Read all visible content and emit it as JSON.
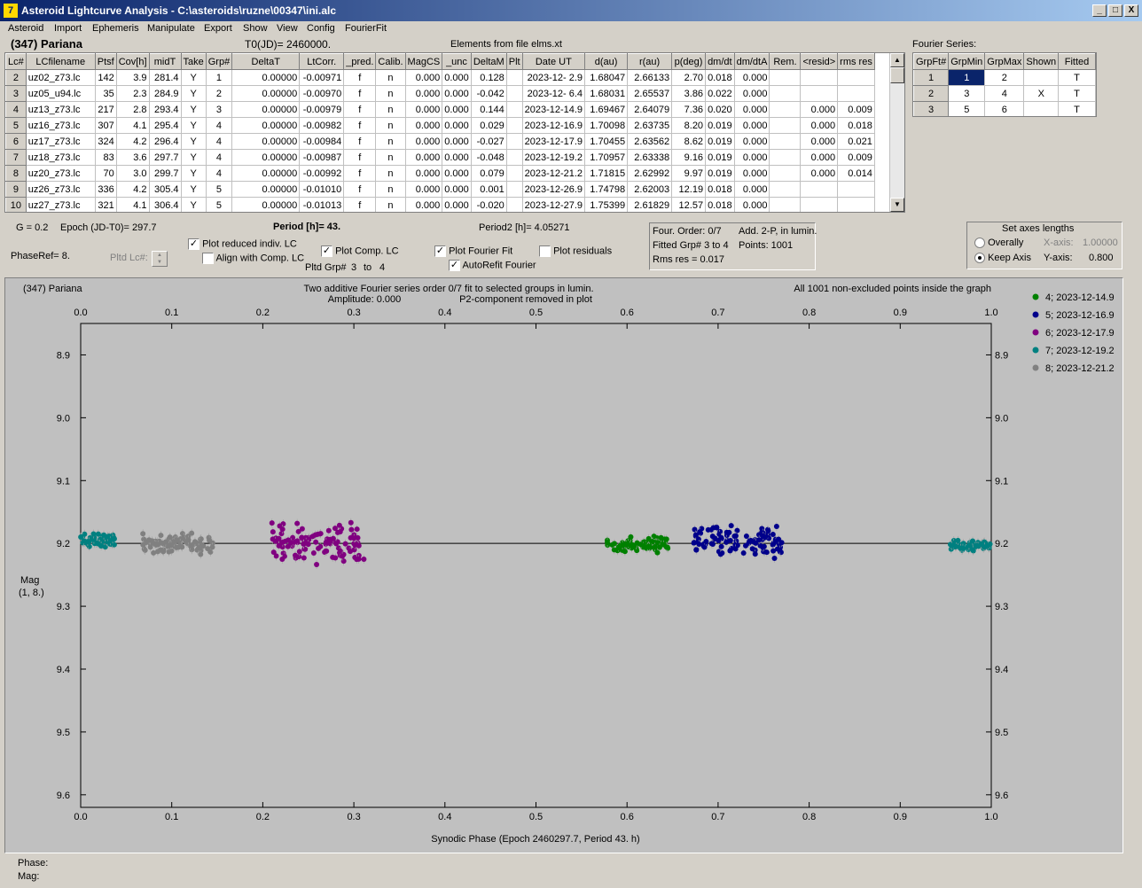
{
  "window": {
    "title": "Asteroid Lightcurve Analysis - C:\\asteroids\\ruzne\\00347\\ini.alc",
    "icon_name": "app-icon",
    "buttons": {
      "minimize": "_",
      "maximize": "□",
      "close": "X"
    }
  },
  "menu": [
    "Asteroid",
    "Import",
    "Ephemeris",
    "Manipulate",
    "Export",
    "Show",
    "View",
    "Config",
    "FourierFit"
  ],
  "header": {
    "object": "(347) Pariana",
    "t0": "T0(JD)= 2460000.",
    "elements": "Elements from file elms.xt",
    "fourier_label": "Fourier Series:"
  },
  "lc_table": {
    "columns": [
      "Lc#",
      "LCfilename",
      "Ptsf",
      "Cov[h]",
      "midT",
      "Take",
      "Grp#",
      "DeltaT",
      "LtCorr.",
      "_pred.",
      "Calib.",
      "MagCS",
      "_unc",
      "DeltaM",
      "Plt",
      "Date UT",
      "d(au)",
      "r(au)",
      "p(deg)",
      "dm/dt",
      "dm/dtA",
      "Rem.",
      "<resid>",
      "rms res"
    ],
    "rows": [
      [
        "2",
        "uz02_z73.lc",
        "142",
        "3.9",
        "281.4",
        "Y",
        "1",
        "0.00000",
        "-0.00971",
        "f",
        "n",
        "0.000",
        "0.000",
        "0.128",
        "",
        "2023-12- 2.9",
        "1.68047",
        "2.66133",
        "2.70",
        "0.018",
        "0.000",
        "",
        "",
        ""
      ],
      [
        "3",
        "uz05_u94.lc",
        "35",
        "2.3",
        "284.9",
        "Y",
        "2",
        "0.00000",
        "-0.00970",
        "f",
        "n",
        "0.000",
        "0.000",
        "-0.042",
        "",
        "2023-12- 6.4",
        "1.68031",
        "2.65537",
        "3.86",
        "0.022",
        "0.000",
        "",
        "",
        ""
      ],
      [
        "4",
        "uz13_z73.lc",
        "217",
        "2.8",
        "293.4",
        "Y",
        "3",
        "0.00000",
        "-0.00979",
        "f",
        "n",
        "0.000",
        "0.000",
        "0.144",
        "",
        "2023-12-14.9",
        "1.69467",
        "2.64079",
        "7.36",
        "0.020",
        "0.000",
        "",
        "0.000",
        "0.009"
      ],
      [
        "5",
        "uz16_z73.lc",
        "307",
        "4.1",
        "295.4",
        "Y",
        "4",
        "0.00000",
        "-0.00982",
        "f",
        "n",
        "0.000",
        "0.000",
        "0.029",
        "",
        "2023-12-16.9",
        "1.70098",
        "2.63735",
        "8.20",
        "0.019",
        "0.000",
        "",
        "0.000",
        "0.018"
      ],
      [
        "6",
        "uz17_z73.lc",
        "324",
        "4.2",
        "296.4",
        "Y",
        "4",
        "0.00000",
        "-0.00984",
        "f",
        "n",
        "0.000",
        "0.000",
        "-0.027",
        "",
        "2023-12-17.9",
        "1.70455",
        "2.63562",
        "8.62",
        "0.019",
        "0.000",
        "",
        "0.000",
        "0.021"
      ],
      [
        "7",
        "uz18_z73.lc",
        "83",
        "3.6",
        "297.7",
        "Y",
        "4",
        "0.00000",
        "-0.00987",
        "f",
        "n",
        "0.000",
        "0.000",
        "-0.048",
        "",
        "2023-12-19.2",
        "1.70957",
        "2.63338",
        "9.16",
        "0.019",
        "0.000",
        "",
        "0.000",
        "0.009"
      ],
      [
        "8",
        "uz20_z73.lc",
        "70",
        "3.0",
        "299.7",
        "Y",
        "4",
        "0.00000",
        "-0.00992",
        "f",
        "n",
        "0.000",
        "0.000",
        "0.079",
        "",
        "2023-12-21.2",
        "1.71815",
        "2.62992",
        "9.97",
        "0.019",
        "0.000",
        "",
        "0.000",
        "0.014"
      ],
      [
        "9",
        "uz26_z73.lc",
        "336",
        "4.2",
        "305.4",
        "Y",
        "5",
        "0.00000",
        "-0.01010",
        "f",
        "n",
        "0.000",
        "0.000",
        "0.001",
        "",
        "2023-12-26.9",
        "1.74798",
        "2.62003",
        "12.19",
        "0.018",
        "0.000",
        "",
        "",
        ""
      ],
      [
        "10",
        "uz27_z73.lc",
        "321",
        "4.1",
        "306.4",
        "Y",
        "5",
        "0.00000",
        "-0.01013",
        "f",
        "n",
        "0.000",
        "0.000",
        "-0.020",
        "",
        "2023-12-27.9",
        "1.75399",
        "2.61829",
        "12.57",
        "0.018",
        "0.000",
        "",
        "",
        ""
      ]
    ]
  },
  "fourier_table": {
    "columns": [
      "GrpFt#",
      "GrpMin",
      "GrpMax",
      "Shown",
      "Fitted"
    ],
    "rows": [
      [
        "1",
        "1",
        "2",
        "",
        "T"
      ],
      [
        "2",
        "3",
        "4",
        "X",
        "T"
      ],
      [
        "3",
        "5",
        "6",
        "",
        "T"
      ]
    ]
  },
  "controls": {
    "g": "G = 0.2",
    "epoch": "Epoch (JD-T0)= 297.7",
    "period": "Period [h]= 43.",
    "period2": "Period2 [h]= 4.05271",
    "phaseref": "PhaseRef= 8.",
    "pltd_lc": "Pltd Lc#:",
    "pltd_grp": "Pltd Grp#",
    "grp_from": "3",
    "to": "to",
    "grp_to": "4",
    "plot_reduced": "Plot reduced indiv. LC",
    "align_comp": "Align with Comp. LC",
    "plot_comp": "Plot Comp. LC",
    "plot_fourier": "Plot Fourier Fit",
    "autorefit": "AutoRefit Fourier",
    "plot_residuals": "Plot residuals",
    "four_order": "Four. Order:  0/7",
    "add2p": "Add. 2-P, in lumin.",
    "fitted_grp": "Fitted Grp# 3 to 4",
    "points": "Points: 1001",
    "rms": "Rms res     = 0.017",
    "axes_title": "Set axes lengths",
    "overally": "Overally",
    "keep_axis": "Keep Axis",
    "xaxis_label": "X-axis:",
    "xaxis_val": "1.00000",
    "yaxis_label": "Y-axis:",
    "yaxis_val": "0.800"
  },
  "status": {
    "phase": "Phase:",
    "mag": "Mag:"
  },
  "chart_data": {
    "type": "scatter",
    "title_left": "(347) Pariana",
    "title_center_1": "Two additive Fourier series order 0/7 fit to selected groups in lumin.",
    "title_center_2": "Amplitude: 0.000",
    "title_center_3": "P2-component removed in plot",
    "title_right": "All 1001 non-excluded points inside the graph",
    "xlabel": "Synodic Phase (Epoch 2460297.7, Period 43. h)",
    "ylabel": "Mag",
    "ylabel2": "(1, 8.)",
    "xlim": [
      0,
      1
    ],
    "ylim": [
      9.62,
      8.85
    ],
    "inverted_y": true,
    "xticks": [
      "0.0",
      "0.1",
      "0.2",
      "0.3",
      "0.4",
      "0.5",
      "0.6",
      "0.7",
      "0.8",
      "0.9",
      "1.0"
    ],
    "yticks": [
      "8.9",
      "9.0",
      "9.1",
      "9.2",
      "9.3",
      "9.4",
      "9.5",
      "9.6"
    ],
    "fit_line_mag": 9.2,
    "legend_position": "right",
    "series": [
      {
        "name": "4; 2023-12-14.9",
        "color": "#008000",
        "segments": [
          {
            "x0": 0.578,
            "x1": 0.645,
            "mean": 9.202,
            "spread": 0.01
          }
        ]
      },
      {
        "name": "5; 2023-12-16.9",
        "color": "#00008b",
        "segments": [
          {
            "x0": 0.673,
            "x1": 0.77,
            "mean": 9.197,
            "spread": 0.018
          }
        ]
      },
      {
        "name": "6; 2023-12-17.9",
        "color": "#800080",
        "segments": [
          {
            "x0": 0.21,
            "x1": 0.312,
            "mean": 9.2,
            "spread": 0.022
          }
        ]
      },
      {
        "name": "7; 2023-12-19.2",
        "color": "#008080",
        "segments": [
          {
            "x0": 0.0,
            "x1": 0.038,
            "mean": 9.195,
            "spread": 0.008
          },
          {
            "x0": 0.955,
            "x1": 1.0,
            "mean": 9.204,
            "spread": 0.006
          }
        ]
      },
      {
        "name": "8; 2023-12-21.2",
        "color": "#808080",
        "segments": [
          {
            "x0": 0.068,
            "x1": 0.145,
            "mean": 9.2,
            "spread": 0.012
          }
        ]
      }
    ]
  }
}
